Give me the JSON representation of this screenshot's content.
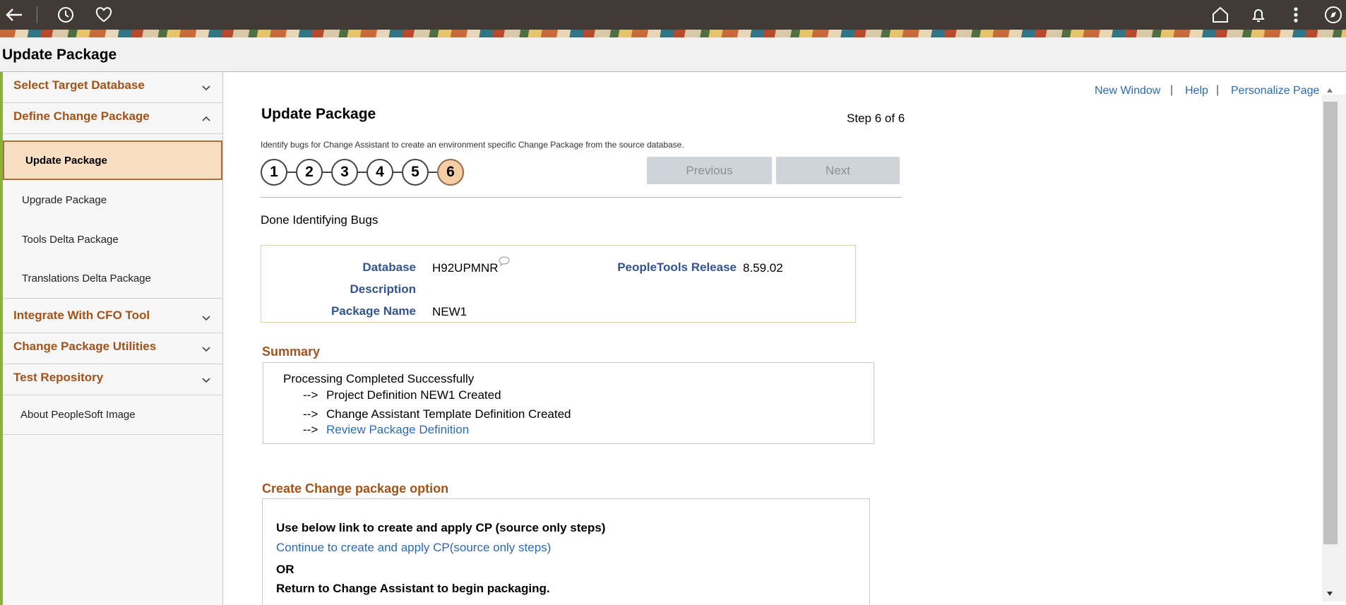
{
  "topbar": {
    "icons": [
      "back-arrow-icon",
      "history-icon",
      "favorites-heart-icon",
      "home-icon",
      "notification-bell-icon",
      "more-vertical-icon",
      "navigator-compass-icon"
    ]
  },
  "page_header": {
    "title": "Update Package"
  },
  "sidebar": {
    "groups": [
      {
        "label": "Select Target Database",
        "expanded": false
      },
      {
        "label": "Define Change Package",
        "expanded": true
      },
      {
        "label": "Integrate With CFO Tool",
        "expanded": false
      },
      {
        "label": "Change Package Utilities",
        "expanded": false
      },
      {
        "label": "Test Repository",
        "expanded": false
      }
    ],
    "items": [
      {
        "label": "Update Package",
        "active": true
      },
      {
        "label": "Upgrade Package"
      },
      {
        "label": "Tools Delta Package"
      },
      {
        "label": "Translations Delta Package"
      }
    ],
    "about": "About PeopleSoft Image"
  },
  "toplinks": {
    "new_window": "New Window",
    "help": "Help",
    "personalize": "Personalize Page",
    "separator": "|"
  },
  "main": {
    "title": "Update Package",
    "step_indicator": "Step 6 of 6",
    "instructions": "Identify bugs for Change Assistant to create an environment specific Change Package from the source database.",
    "steps": [
      "1",
      "2",
      "3",
      "4",
      "5",
      "6"
    ],
    "current_step": 6,
    "previous_label": "Previous",
    "next_label": "Next",
    "status": "Done Identifying Bugs",
    "info": {
      "database_label": "Database",
      "database_value": "H92UPMNR",
      "description_label": "Description",
      "package_name_label": "Package Name",
      "package_name_value": "NEW1",
      "peopletools_label": "PeopleTools Release",
      "peopletools_value": "8.59.02"
    },
    "summary": {
      "title": "Summary",
      "headline": "Processing Completed Successfully",
      "arrow": "-->",
      "lines": [
        "Project Definition NEW1 Created",
        "Change Assistant Template Definition Created"
      ],
      "review_link": "Review Package Definition"
    },
    "create_option": {
      "title": "Create Change package option",
      "instruction": "Use below link to create and apply CP (source only steps)",
      "link": "Continue to create and apply CP(source only steps)",
      "or": "OR",
      "return_text": "Return to Change Assistant to begin packaging."
    }
  },
  "colors": {
    "topbar": "#413b36",
    "section_orange": "#a15319",
    "label_blue": "#32548f",
    "link_blue": "#2b6bb5",
    "active_item": "#f8dfc1",
    "current_step": "#f5cea5"
  }
}
